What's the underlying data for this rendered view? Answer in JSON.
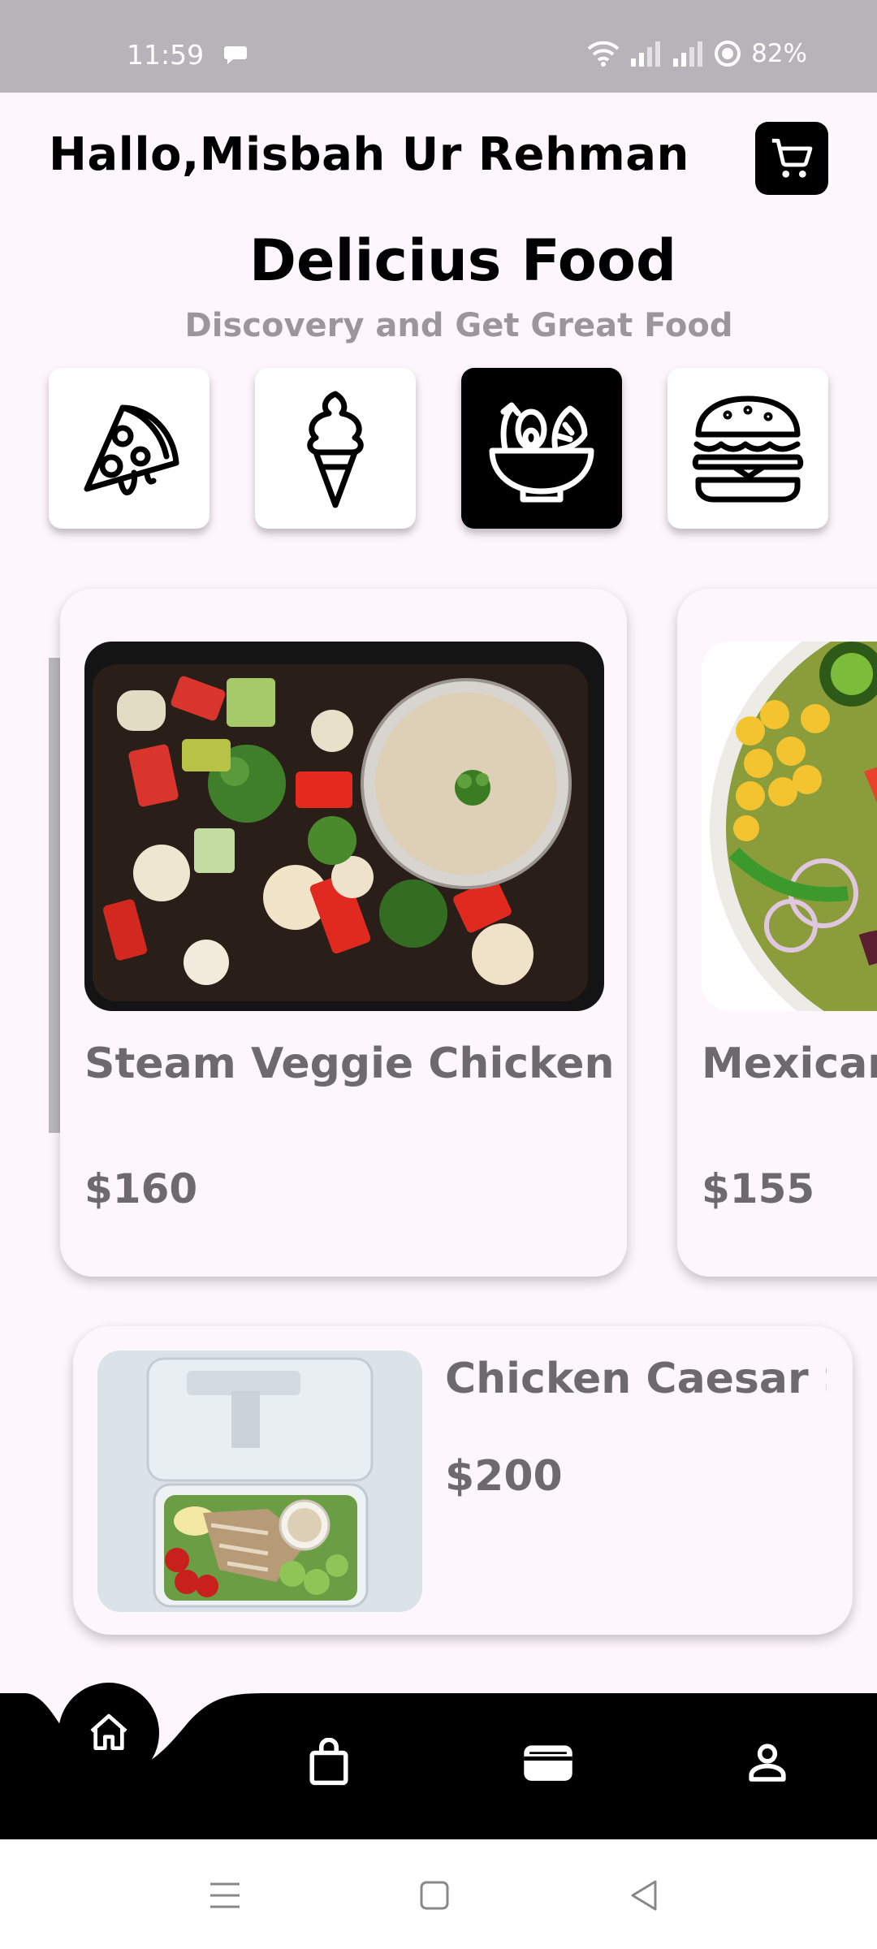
{
  "status_bar": {
    "time": "11:59",
    "battery": "82%"
  },
  "header": {
    "greeting": "Hallo,Misbah Ur Rehman",
    "title": "Delicius Food",
    "subtitle": "Discovery and Get Great Food"
  },
  "categories": [
    {
      "icon": "pizza-icon",
      "active": false
    },
    {
      "icon": "ice-cream-icon",
      "active": false
    },
    {
      "icon": "salad-bowl-icon",
      "active": true
    },
    {
      "icon": "burger-icon",
      "active": false
    }
  ],
  "featured": [
    {
      "name": "Steam Veggie Chicken",
      "price": "$160"
    },
    {
      "name": "Mexican",
      "price": "$155"
    }
  ],
  "list": [
    {
      "name": "Chicken Caesar Salad",
      "price": "$200"
    }
  ],
  "bottom_nav": [
    "home-icon",
    "shopping-bag-icon",
    "wallet-icon",
    "profile-icon"
  ],
  "colors": {
    "background": "#fdf6fc",
    "accent": "#000000",
    "muted_text": "#6c6a6d",
    "subtitle": "#9a969a"
  }
}
